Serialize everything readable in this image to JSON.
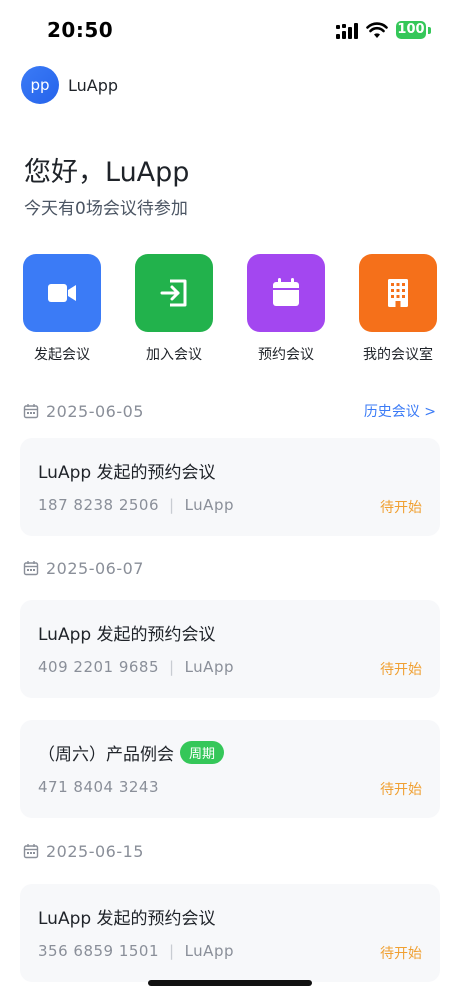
{
  "status_bar": {
    "time": "20:50",
    "battery": "100"
  },
  "user": {
    "avatar_text": "pp",
    "name": "LuApp"
  },
  "greeting": {
    "title": "您好，LuApp",
    "subtitle": "今天有0场会议待参加"
  },
  "actions": [
    {
      "label": "发起会议",
      "icon": "video-camera-icon",
      "color": "#3b7bf6"
    },
    {
      "label": "加入会议",
      "icon": "enter-arrow-icon",
      "color": "#22b24c"
    },
    {
      "label": "预约会议",
      "icon": "calendar-icon",
      "color": "#a347f0"
    },
    {
      "label": "我的会议室",
      "icon": "building-icon",
      "color": "#f5701a"
    }
  ],
  "history_link": "历史会议 >",
  "groups": [
    {
      "date": "2025-06-05",
      "meetings": [
        {
          "title": "LuApp 发起的预约会议",
          "number": "187 8238 2506",
          "host": "LuApp",
          "status": "待开始"
        }
      ]
    },
    {
      "date": "2025-06-07",
      "meetings": [
        {
          "title": "LuApp 发起的预约会议",
          "number": "409 2201 9685",
          "host": "LuApp",
          "status": "待开始"
        },
        {
          "title": "（周六）产品例会",
          "badge": "周期",
          "number": "471 8404 3243",
          "status": "待开始"
        }
      ]
    },
    {
      "date": "2025-06-15",
      "meetings": [
        {
          "title": "LuApp 发起的预约会议",
          "number": "356 6859 1501",
          "host": "LuApp",
          "status": "待开始"
        }
      ]
    }
  ]
}
